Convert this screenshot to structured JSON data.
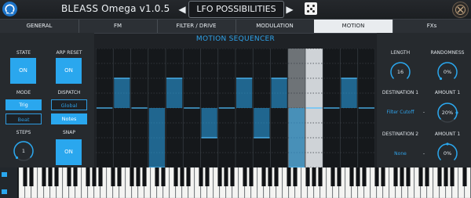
{
  "app": {
    "title": "BLEASS Omega  v1.0.5"
  },
  "preset": {
    "name": "LFO POSSIBILITIES",
    "prev_icon": "◀",
    "next_icon": "▶"
  },
  "tabs": [
    {
      "label": "GENERAL",
      "active": false
    },
    {
      "label": "FM",
      "active": false
    },
    {
      "label": "FILTER / DRIVE",
      "active": false
    },
    {
      "label": "MODULATION",
      "active": false
    },
    {
      "label": "MOTION",
      "active": true
    },
    {
      "label": "FXs",
      "active": false
    }
  ],
  "left": {
    "state_label": "STATE",
    "state_value": "ON",
    "arp_reset_label": "ARP RESET",
    "arp_reset_value": "ON",
    "mode_label": "MODE",
    "mode_options": [
      "Trig",
      "Beat"
    ],
    "mode_selected": "Trig",
    "dispatch_label": "DISPATCH",
    "dispatch_options": [
      "Global",
      "Notes"
    ],
    "dispatch_selected": "Global",
    "steps_label": "STEPS",
    "steps_value": "1",
    "snap_label": "SNAP",
    "snap_value": "ON"
  },
  "sequencer": {
    "title": "MOTION SEQUENCER",
    "columns": 16,
    "column_values": [
      0,
      0.25,
      0,
      -0.5,
      0.25,
      0,
      -0.25,
      0,
      0.25,
      -0.25,
      0.25,
      -0.5,
      0,
      0,
      0.25,
      0
    ],
    "highlighted_columns": [
      11,
      12
    ],
    "accent": "#2aa7ee"
  },
  "right": {
    "length_label": "LENGTH",
    "length_value": "16",
    "randomness_label": "RANDOMNESS",
    "randomness_value": "0%",
    "dest1_label": "DESTINATION 1",
    "dest1_value": "Filter Cutoff",
    "amount1_label": "AMOUNT 1",
    "amount1_value": "20%",
    "dest2_label": "DESTINATION 2",
    "dest2_value": "None",
    "amount2_label": "AMOUNT 1",
    "amount2_value": "0%",
    "dash": "-"
  },
  "colors": {
    "accent": "#2aa7ee",
    "background": "#1f2226"
  }
}
